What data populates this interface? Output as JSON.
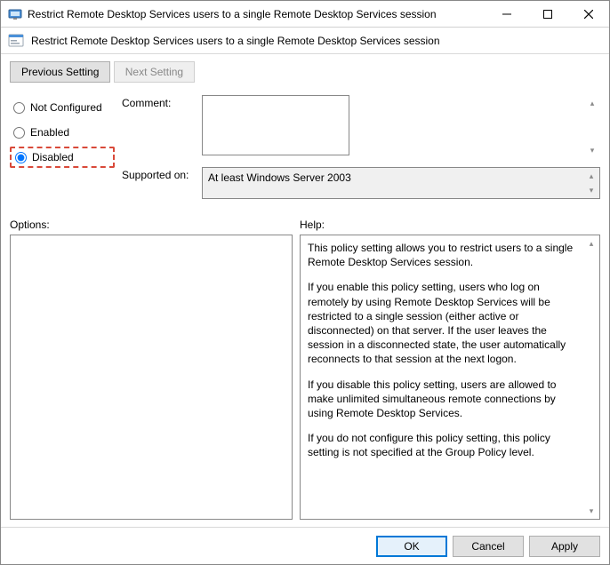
{
  "window": {
    "title": "Restrict Remote Desktop Services users to a single Remote Desktop Services session"
  },
  "subtitle": "Restrict Remote Desktop Services users to a single Remote Desktop Services session",
  "nav": {
    "previous": "Previous Setting",
    "next": "Next Setting"
  },
  "state": {
    "selected": "disabled",
    "options": {
      "not_configured": "Not Configured",
      "enabled": "Enabled",
      "disabled": "Disabled"
    }
  },
  "labels": {
    "comment": "Comment:",
    "supported_on": "Supported on:",
    "options": "Options:",
    "help": "Help:"
  },
  "comment": "",
  "supported_on": "At least Windows Server 2003",
  "help": {
    "p1": "This policy setting allows you to restrict users to a single Remote Desktop Services session.",
    "p2": "If you enable this policy setting, users who log on remotely by using Remote Desktop Services will be restricted to a single session (either active or disconnected) on that server. If the user leaves the session in a disconnected state, the user automatically reconnects to that session at the next logon.",
    "p3": "If you disable this policy setting, users are allowed to make unlimited simultaneous remote connections by using Remote Desktop Services.",
    "p4": "If you do not configure this policy setting,  this policy setting is not specified at the Group Policy level."
  },
  "footer": {
    "ok": "OK",
    "cancel": "Cancel",
    "apply": "Apply"
  }
}
